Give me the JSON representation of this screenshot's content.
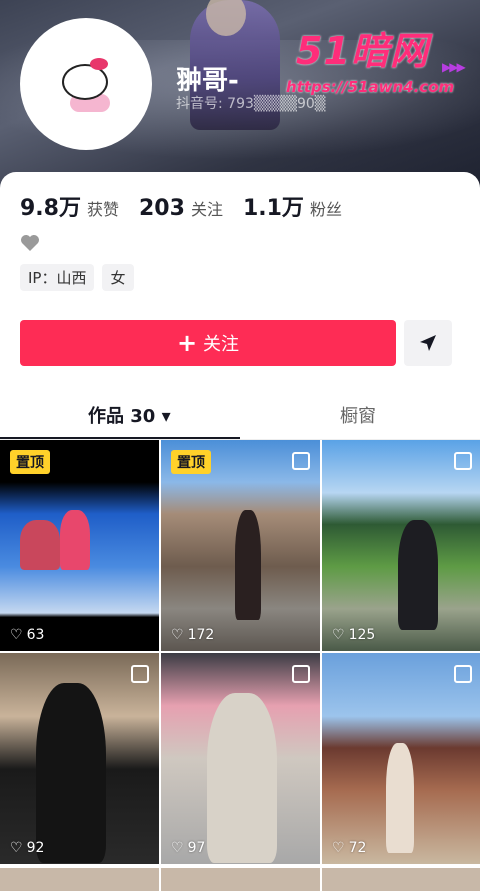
{
  "profile": {
    "username": "翀哥-",
    "douyin_id": "抖音号: 793▒▒▒▒90▒",
    "watermark_logo": "51暗网",
    "watermark_url": "https://51awn4.com"
  },
  "stats": [
    {
      "num": "9.8万",
      "label": "获赞"
    },
    {
      "num": "203",
      "label": "关注"
    },
    {
      "num": "1.1万",
      "label": "粉丝"
    }
  ],
  "tags": [
    "IP：山西",
    "女"
  ],
  "actions": {
    "follow_label": "关注",
    "follow_plus": "+"
  },
  "tabs": {
    "works": "作品 30 ▾",
    "window": "橱窗"
  },
  "posts": [
    {
      "pinned": true,
      "pin_label": "置顶",
      "likes": "63"
    },
    {
      "pinned": true,
      "pin_label": "置顶",
      "likes": "172"
    },
    {
      "pinned": false,
      "likes": "125"
    },
    {
      "pinned": false,
      "likes": "92"
    },
    {
      "pinned": false,
      "likes": "97"
    },
    {
      "pinned": false,
      "likes": "72"
    }
  ],
  "colors": {
    "accent": "#fe2c55",
    "pin": "#ffd12a",
    "watermark": "#ff2d7a"
  }
}
